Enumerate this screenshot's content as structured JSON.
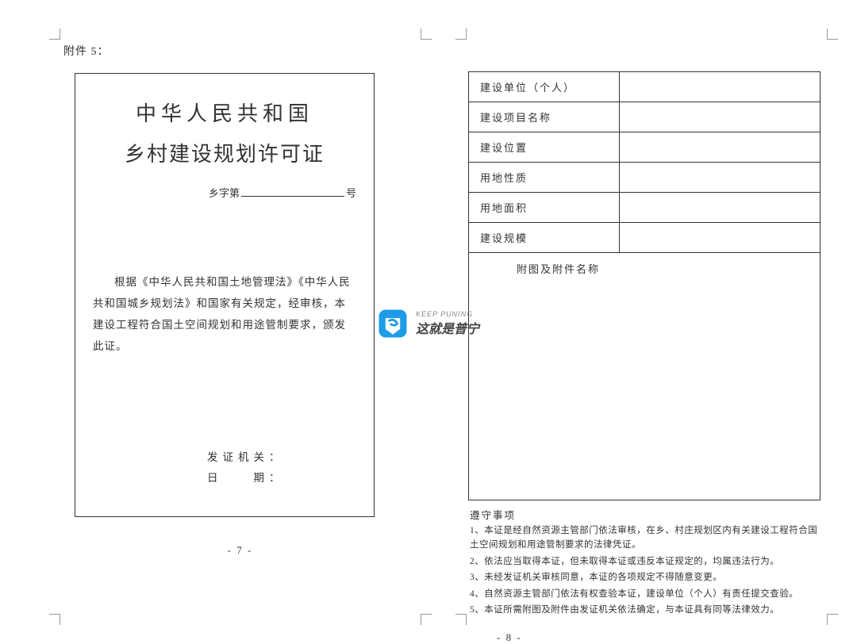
{
  "attachment_label": "附件 5：",
  "cert": {
    "title_line1": "中华人民共和国",
    "title_line2": "乡村建设规划许可证",
    "no_prefix": "乡字第",
    "no_suffix": "号",
    "body": "根据《中华人民共和国土地管理法》《中华人民共和国城乡规划法》和国家有关规定，经审核，本建设工程符合国土空间规划和用途管制要求，颁发此证。",
    "issuer_label": "发证机关：",
    "date_label": "日　　期："
  },
  "page_num_left": "- 7 -",
  "page_num_right": "- 8 -",
  "form": {
    "r1": "建设单位（个人）",
    "r2": "建设项目名称",
    "r3": "建设位置",
    "r4": "用地性质",
    "r5": "用地面积",
    "r6": "建设规模",
    "attach_header": "附图及附件名称"
  },
  "notes": {
    "header": "遵守事项",
    "n1": "1、本证是经自然资源主管部门依法审核，在乡、村庄规划区内有关建设工程符合国土空间规划和用途管制要求的法律凭证。",
    "n2": "2、依法应当取得本证，但未取得本证或违反本证规定的，均属违法行为。",
    "n3": "3、未经发证机关审核同意，本证的各项规定不得随意变更。",
    "n4": "4、自然资源主管部门依法有权查验本证，建设单位（个人）有责任提交查验。",
    "n5": "5、本证所需附图及附件由发证机关依法确定，与本证具有同等法律效力。"
  },
  "watermark": {
    "small": "KEEP PUNING",
    "big": "这就是普宁"
  }
}
